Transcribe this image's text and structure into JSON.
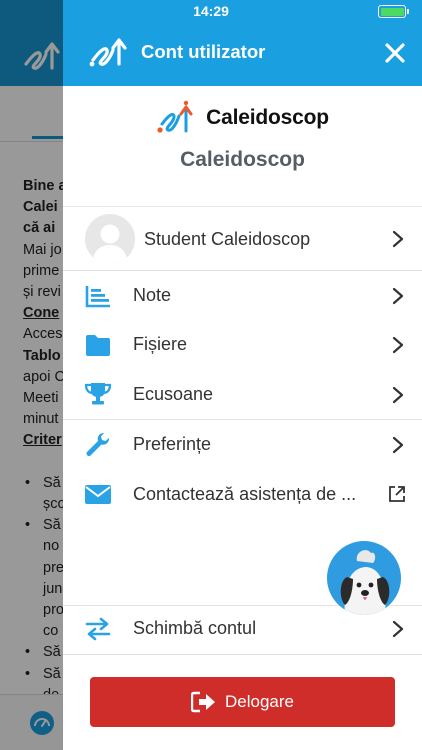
{
  "status_bar": {
    "time": "14:29"
  },
  "background": {
    "lines": [
      {
        "text": "Bine a",
        "style": "b"
      },
      {
        "text": "Calei",
        "style": "b"
      },
      {
        "text": "că ai",
        "style": "b"
      },
      {
        "text": "Mai jo",
        "style": ""
      },
      {
        "text": "prime",
        "style": ""
      },
      {
        "text": "și revi",
        "style": ""
      },
      {
        "text": "Cone",
        "style": "u"
      },
      {
        "text": "Acces",
        "style": ""
      },
      {
        "text": "Tablo",
        "style": "b"
      },
      {
        "text": "apoi C",
        "style": ""
      },
      {
        "text": "Meeti",
        "style": ""
      },
      {
        "text": "minut",
        "style": ""
      },
      {
        "text": "Criter",
        "style": "u"
      },
      {
        "text": "",
        "style": ""
      },
      {
        "text": "Să",
        "style": "bul"
      },
      {
        "text": "șco",
        "style": "ind"
      },
      {
        "text": "Să",
        "style": "bul"
      },
      {
        "text": "no",
        "style": "ind"
      },
      {
        "text": "pre",
        "style": "ind"
      },
      {
        "text": "jun",
        "style": "ind"
      },
      {
        "text": "pro",
        "style": "ind"
      },
      {
        "text": "co",
        "style": "ind"
      },
      {
        "text": "Să",
        "style": "bul"
      },
      {
        "text": "Să",
        "style": "bul"
      },
      {
        "text": "de",
        "style": "ind"
      },
      {
        "text": "rev",
        "style": "ind"
      }
    ]
  },
  "drawer": {
    "header_title": "Cont utilizator",
    "brand_logo_text": "Caleidoscop",
    "brand_name": "Caleidoscop",
    "user": {
      "name": "Student Caleidoscop"
    },
    "menu": [
      {
        "key": "note",
        "label": "Note",
        "icon": "list-chart-icon"
      },
      {
        "key": "fisiere",
        "label": "Fișiere",
        "icon": "folder-icon"
      },
      {
        "key": "ecusoane",
        "label": "Ecusoane",
        "icon": "trophy-icon"
      },
      {
        "key": "preferinte",
        "label": "Preferințe",
        "icon": "wrench-icon"
      },
      {
        "key": "contact",
        "label": "Contactează asistența de ...",
        "icon": "envelope-icon"
      },
      {
        "key": "schimba",
        "label": "Schimbă contul",
        "icon": "swap-arrows-icon"
      }
    ],
    "logout_label": "Delogare"
  },
  "colors": {
    "header_blue": "#1a9fe0",
    "icon_blue": "#2aa3e6",
    "logout_red": "#cf2d2a",
    "brand_gray": "#555d66",
    "logo_orange": "#f05a28"
  }
}
